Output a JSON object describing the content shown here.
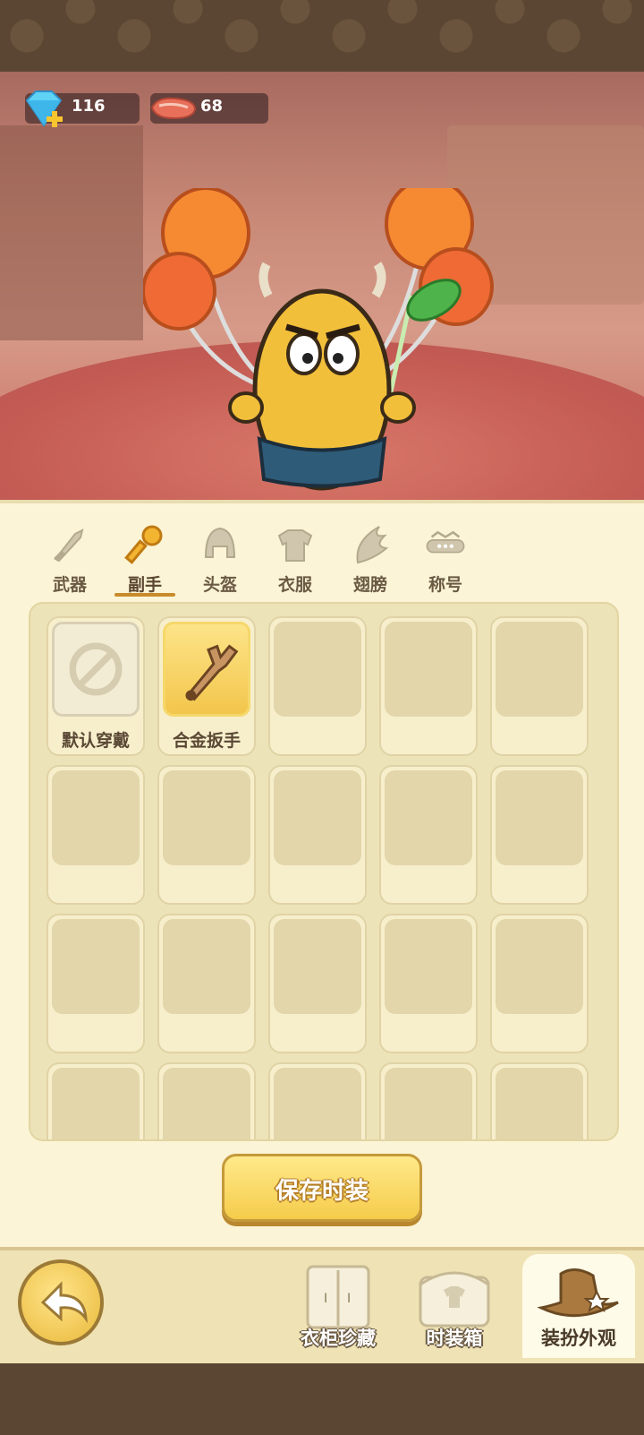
{
  "currency": {
    "gems": "116",
    "meat": "68"
  },
  "tabs": [
    {
      "label": "武器",
      "icon": "sword-icon"
    },
    {
      "label": "副手",
      "icon": "key-icon"
    },
    {
      "label": "头盔",
      "icon": "helmet-icon"
    },
    {
      "label": "衣服",
      "icon": "armor-icon"
    },
    {
      "label": "翅膀",
      "icon": "wing-icon"
    },
    {
      "label": "称号",
      "icon": "title-crown-icon"
    }
  ],
  "active_tab": "副手",
  "items": [
    {
      "label": "默认穿戴",
      "icon": "no-entry-icon"
    },
    {
      "label": "合金扳手",
      "icon": "wrench-icon"
    }
  ],
  "save_button": "保存时装",
  "bottom_nav": [
    {
      "label": "衣柜珍藏",
      "icon": "wardrobe-icon"
    },
    {
      "label": "时装箱",
      "icon": "fashion-box-icon"
    },
    {
      "label": "装扮外观",
      "icon": "hat-icon"
    }
  ],
  "colors": {
    "accent": "#c88a2a",
    "panel": "#fbf4d6",
    "button": "#f5cc4b"
  }
}
